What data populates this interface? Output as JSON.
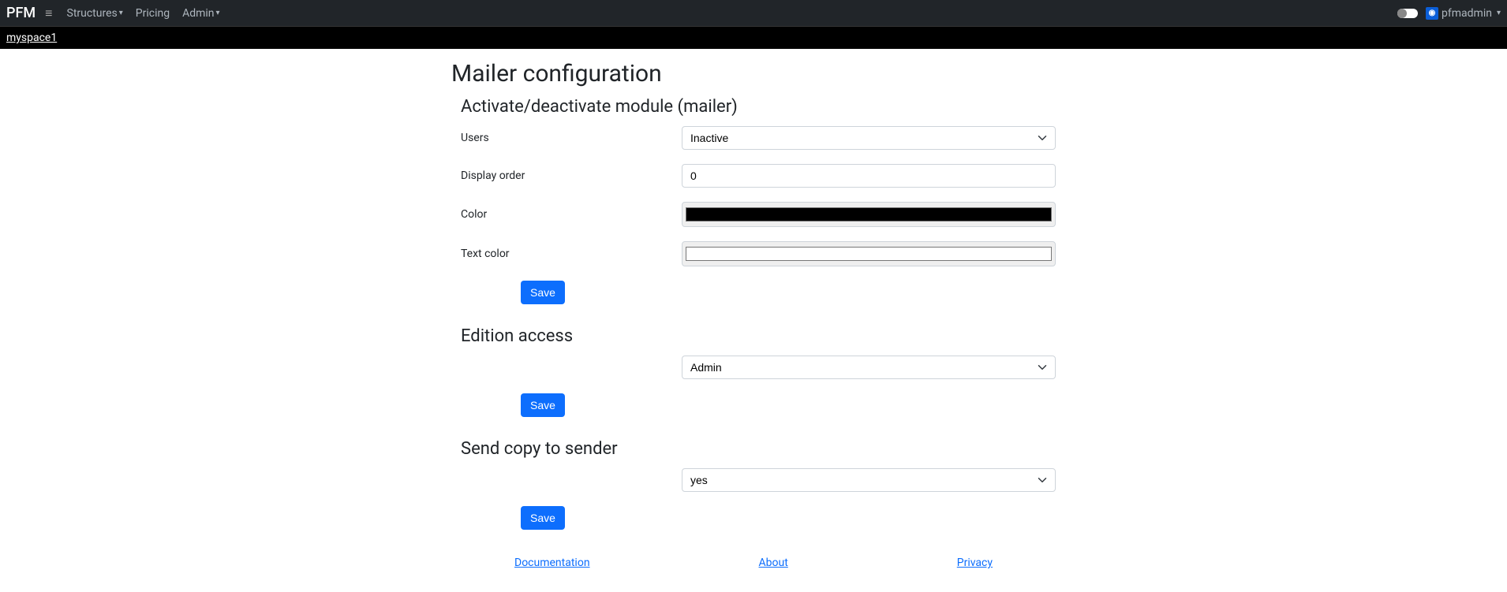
{
  "nav": {
    "brand": "PFM",
    "links": [
      "Structures",
      "Pricing",
      "Admin"
    ],
    "user": "pfmadmin"
  },
  "breadcrumb": {
    "space": "myspace1"
  },
  "page": {
    "title": "Mailer configuration"
  },
  "sections": {
    "activate": {
      "title": "Activate/deactivate module (mailer)",
      "users_label": "Users",
      "users_value": "Inactive",
      "display_order_label": "Display order",
      "display_order_value": "0",
      "color_label": "Color",
      "color_value": "#000000",
      "text_color_label": "Text color",
      "text_color_value": "#ffffff",
      "save": "Save"
    },
    "edition": {
      "title": "Edition access",
      "value": "Admin",
      "save": "Save"
    },
    "sendcopy": {
      "title": "Send copy to sender",
      "value": "yes",
      "save": "Save"
    }
  },
  "footer": {
    "doc": "Documentation",
    "about": "About",
    "privacy": "Privacy"
  }
}
